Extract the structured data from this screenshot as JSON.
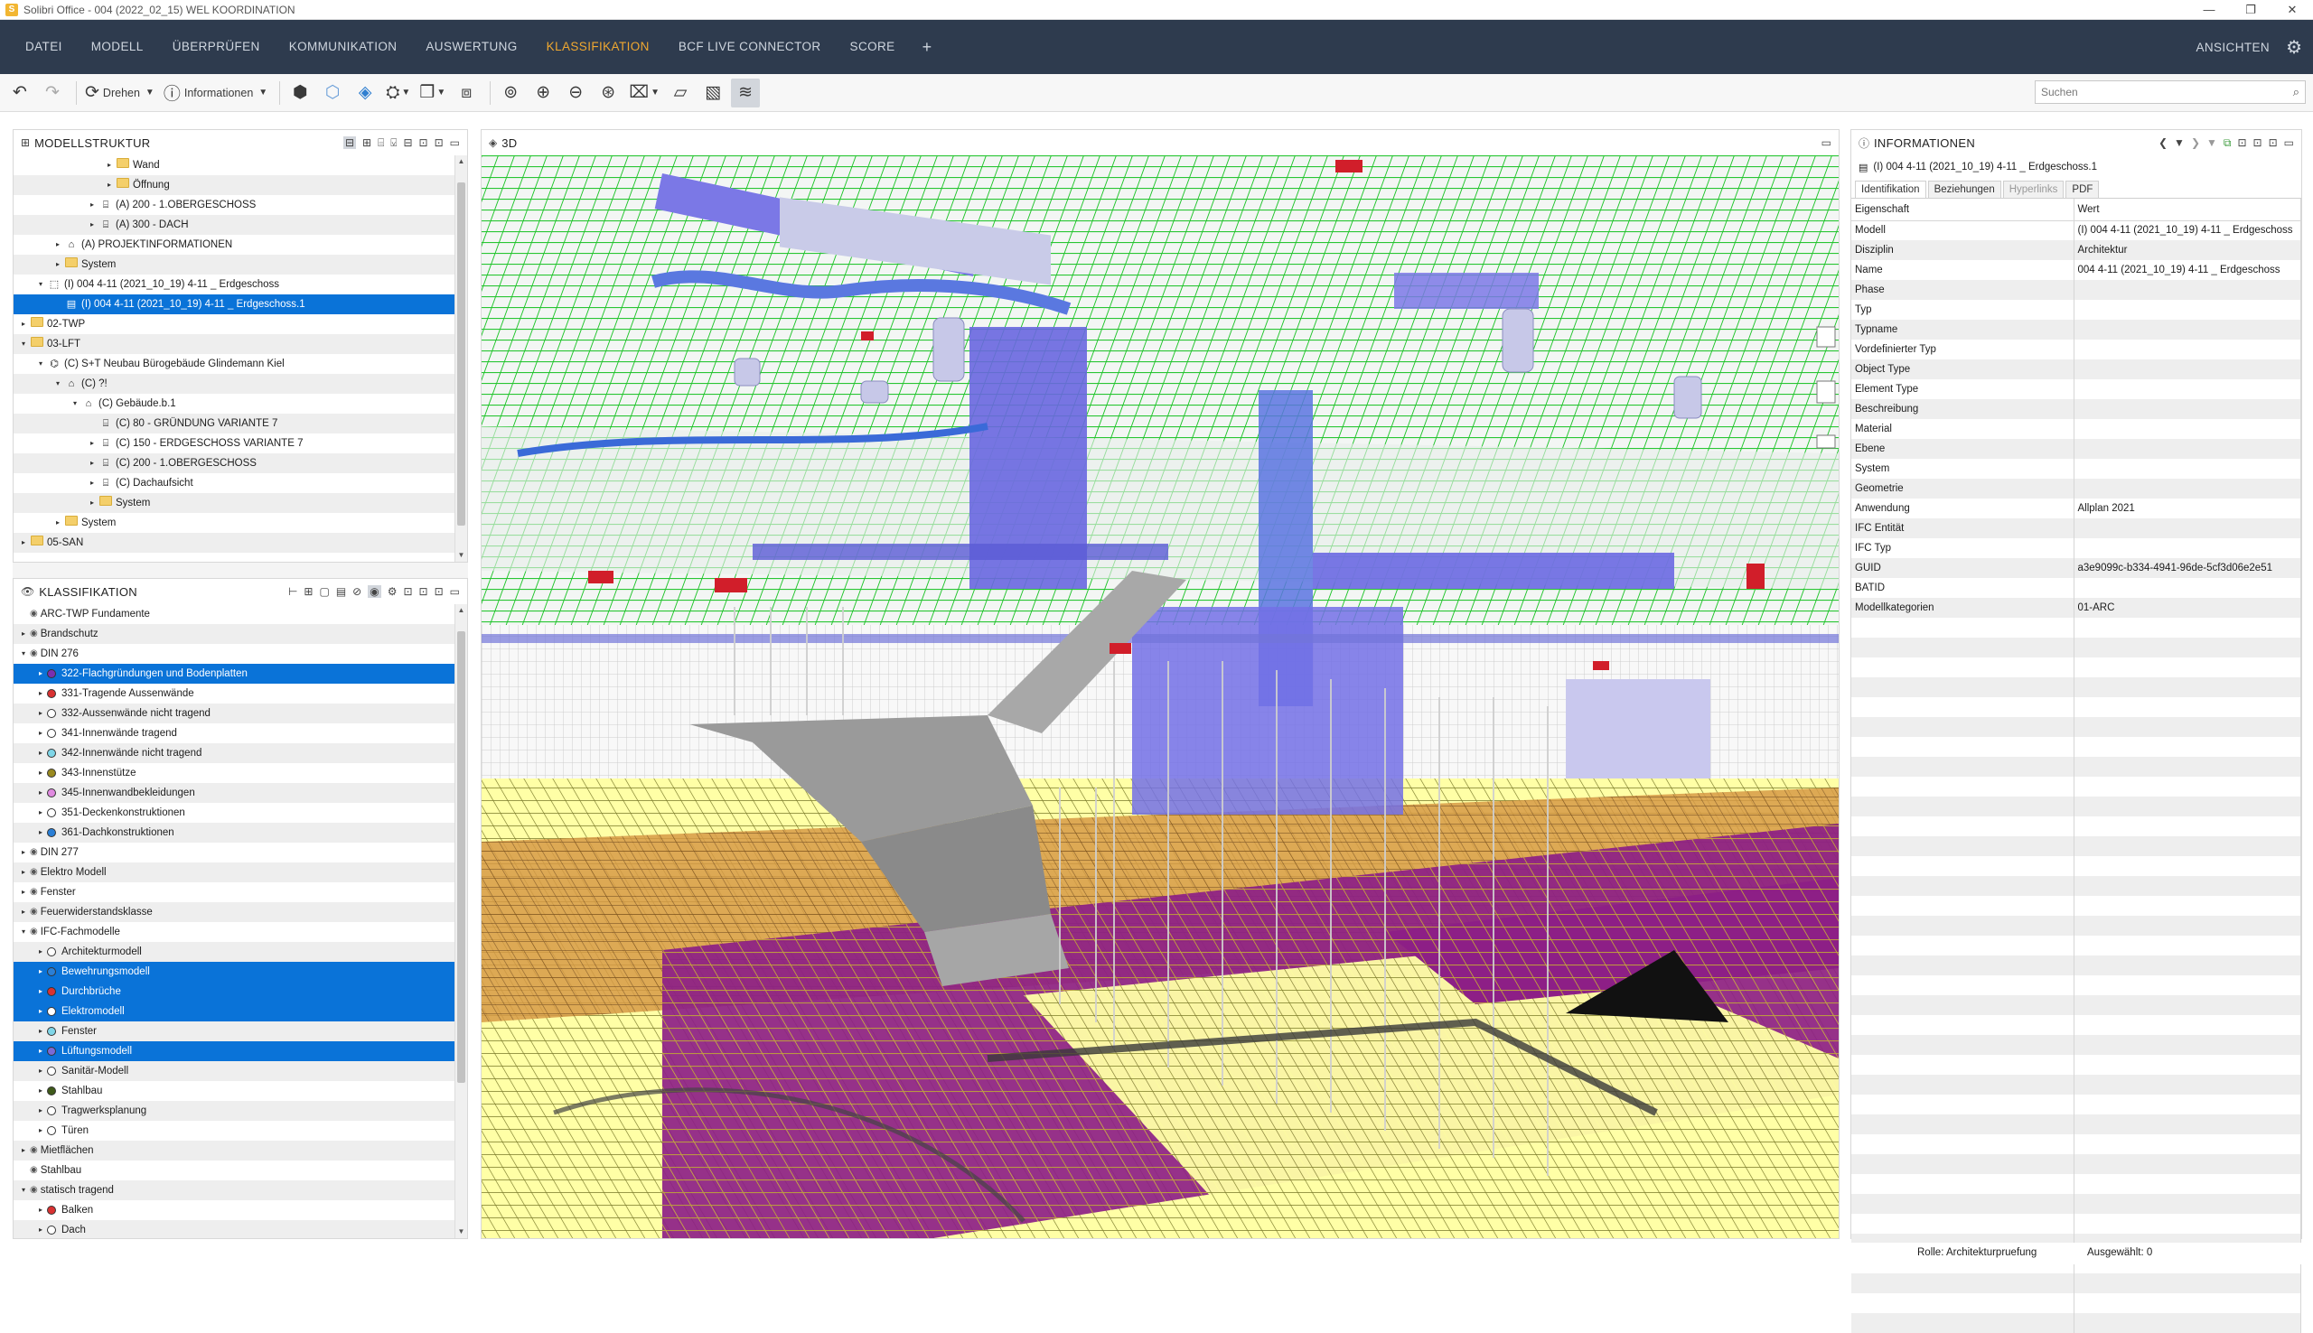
{
  "window": {
    "title": "Solibri Office - 004 (2022_02_15) WEL KOORDINATION",
    "buttons": [
      "—",
      "❐",
      "✕"
    ]
  },
  "menu": {
    "items": [
      "DATEI",
      "MODELL",
      "ÜBERPRÜFEN",
      "KOMMUNIKATION",
      "AUSWERTUNG",
      "KLASSIFIKATION",
      "BCF LIVE CONNECTOR",
      "SCORE"
    ],
    "active": "KLASSIFIKATION",
    "plus": "+",
    "ansichten": "ANSICHTEN"
  },
  "toolbar": {
    "drehen": "Drehen",
    "informationen": "Informationen",
    "search_placeholder": "Suchen"
  },
  "model_panel": {
    "title": "MODELLSTRUKTUR",
    "rows": [
      {
        "indent": 5,
        "exp": "▸",
        "icon": "folder",
        "label": "Wand"
      },
      {
        "indent": 5,
        "exp": "▸",
        "icon": "folder",
        "label": "Öffnung"
      },
      {
        "indent": 4,
        "exp": "▸",
        "icon": "storey",
        "label": "(A) 200 - 1.OBERGESCHOSS"
      },
      {
        "indent": 4,
        "exp": "▸",
        "icon": "storey",
        "label": "(A) 300 - DACH"
      },
      {
        "indent": 2,
        "exp": "▸",
        "icon": "site",
        "label": "(A) PROJEKTINFORMATIONEN"
      },
      {
        "indent": 2,
        "exp": "▸",
        "icon": "folder",
        "label": "System"
      },
      {
        "indent": 1,
        "exp": "▾",
        "icon": "model",
        "label": "(I) 004 4-11  (2021_10_19) 4-11 _ Erdgeschoss"
      },
      {
        "indent": 2,
        "exp": "",
        "icon": "doc",
        "label": "(I) 004 4-11  (2021_10_19) 4-11 _ Erdgeschoss.1",
        "selected": true
      },
      {
        "indent": 0,
        "exp": "▸",
        "icon": "folder",
        "label": "02-TWP"
      },
      {
        "indent": 0,
        "exp": "▾",
        "icon": "folder",
        "label": "03-LFT"
      },
      {
        "indent": 1,
        "exp": "▾",
        "icon": "project",
        "label": "(C) S+T Neubau Bürogebäude Glindemann Kiel"
      },
      {
        "indent": 2,
        "exp": "▾",
        "icon": "site",
        "label": "(C) ?!"
      },
      {
        "indent": 3,
        "exp": "▾",
        "icon": "building",
        "label": "(C) Gebäude.b.1"
      },
      {
        "indent": 4,
        "exp": "",
        "icon": "storey",
        "label": "(C) 80 - GRÜNDUNG VARIANTE 7"
      },
      {
        "indent": 4,
        "exp": "▸",
        "icon": "storey",
        "label": "(C) 150 - ERDGESCHOSS VARIANTE 7"
      },
      {
        "indent": 4,
        "exp": "▸",
        "icon": "storey",
        "label": "(C) 200 - 1.OBERGESCHOSS"
      },
      {
        "indent": 4,
        "exp": "▸",
        "icon": "storey",
        "label": "(C) Dachaufsicht"
      },
      {
        "indent": 4,
        "exp": "▸",
        "icon": "folder",
        "label": "System"
      },
      {
        "indent": 2,
        "exp": "▸",
        "icon": "folder",
        "label": "System"
      },
      {
        "indent": 0,
        "exp": "▸",
        "icon": "folder",
        "label": "05-SAN"
      }
    ]
  },
  "class_panel": {
    "title": "KLASSIFIKATION",
    "rows": [
      {
        "indent": 0,
        "exp": "",
        "dot": "",
        "label": "ARC-TWP Fundamente"
      },
      {
        "indent": 0,
        "exp": "▸",
        "dot": "",
        "label": "Brandschutz"
      },
      {
        "indent": 0,
        "exp": "▾",
        "dot": "",
        "label": "DIN 276"
      },
      {
        "indent": 1,
        "exp": "▸",
        "dot": "#7a2fb0",
        "label": "322-Flachgründungen und Bodenplatten",
        "selected": true
      },
      {
        "indent": 1,
        "exp": "▸",
        "dot": "#d93232",
        "label": "331-Tragende Aussenwände"
      },
      {
        "indent": 1,
        "exp": "▸",
        "dot": "#ffffff",
        "label": "332-Aussenwände nicht tragend"
      },
      {
        "indent": 1,
        "exp": "▸",
        "dot": "#ffffff",
        "label": "341-Innenwände tragend"
      },
      {
        "indent": 1,
        "exp": "▸",
        "dot": "#7fd6e8",
        "label": "342-Innenwände nicht tragend"
      },
      {
        "indent": 1,
        "exp": "▸",
        "dot": "#9a8a20",
        "label": "343-Innenstütze"
      },
      {
        "indent": 1,
        "exp": "▸",
        "dot": "#e08ae0",
        "label": "345-Innenwandbekleidungen"
      },
      {
        "indent": 1,
        "exp": "▸",
        "dot": "#ffffff",
        "label": "351-Deckenkonstruktionen"
      },
      {
        "indent": 1,
        "exp": "▸",
        "dot": "#2a7fd6",
        "label": "361-Dachkonstruktionen"
      },
      {
        "indent": 0,
        "exp": "▸",
        "dot": "",
        "label": "DIN 277"
      },
      {
        "indent": 0,
        "exp": "▸",
        "dot": "",
        "label": "Elektro Modell"
      },
      {
        "indent": 0,
        "exp": "▸",
        "dot": "",
        "label": "Fenster"
      },
      {
        "indent": 0,
        "exp": "▸",
        "dot": "",
        "label": "Feuerwiderstandsklasse"
      },
      {
        "indent": 0,
        "exp": "▾",
        "dot": "",
        "label": "IFC-Fachmodelle"
      },
      {
        "indent": 1,
        "exp": "▸",
        "dot": "#ffffff",
        "label": "Architekturmodell"
      },
      {
        "indent": 1,
        "exp": "▸",
        "dot": "#2a7fd6",
        "label": "Bewehrungsmodell",
        "selected": true
      },
      {
        "indent": 1,
        "exp": "▸",
        "dot": "#d93232",
        "label": "Durchbrüche",
        "selected": true
      },
      {
        "indent": 1,
        "exp": "▸",
        "dot": "#ffffff",
        "label": "Elektromodell",
        "selected": true
      },
      {
        "indent": 1,
        "exp": "▸",
        "dot": "#7fd6e8",
        "label": "Fenster"
      },
      {
        "indent": 1,
        "exp": "▸",
        "dot": "#7a6ad6",
        "label": "Lüftungsmodell",
        "selected": true
      },
      {
        "indent": 1,
        "exp": "▸",
        "dot": "#ffffff",
        "label": "Sanitär-Modell"
      },
      {
        "indent": 1,
        "exp": "▸",
        "dot": "#3f5a1a",
        "label": "Stahlbau"
      },
      {
        "indent": 1,
        "exp": "▸",
        "dot": "#ffffff",
        "label": "Tragwerksplanung"
      },
      {
        "indent": 1,
        "exp": "▸",
        "dot": "#ffffff",
        "label": "Türen"
      },
      {
        "indent": 0,
        "exp": "▸",
        "dot": "",
        "label": "Mietflächen"
      },
      {
        "indent": 0,
        "exp": "",
        "dot": "",
        "label": "Stahlbau"
      },
      {
        "indent": 0,
        "exp": "▾",
        "dot": "",
        "label": "statisch tragend"
      },
      {
        "indent": 1,
        "exp": "▸",
        "dot": "#d93232",
        "label": "Balken"
      },
      {
        "indent": 1,
        "exp": "▸",
        "dot": "#ffffff",
        "label": "Dach"
      }
    ]
  },
  "view3d": {
    "title": "3D"
  },
  "info_panel": {
    "title": "INFORMATIONEN",
    "object": "(I) 004 4-11  (2021_10_19) 4-11 _ Erdgeschoss.1",
    "tabs": [
      "Identifikation",
      "Beziehungen",
      "Hyperlinks",
      "PDF"
    ],
    "active_tab": "Identifikation",
    "col_property": "Eigenschaft",
    "col_value": "Wert",
    "rows": [
      {
        "k": "Modell",
        "v": "(I) 004 4-11  (2021_10_19) 4-11 _ Erdgeschoss"
      },
      {
        "k": "Disziplin",
        "v": "Architektur"
      },
      {
        "k": "Name",
        "v": "004 4-11  (2021_10_19) 4-11 _ Erdgeschoss"
      },
      {
        "k": "Phase",
        "v": ""
      },
      {
        "k": "Typ",
        "v": ""
      },
      {
        "k": "Typname",
        "v": ""
      },
      {
        "k": "Vordefinierter Typ",
        "v": ""
      },
      {
        "k": "Object Type",
        "v": ""
      },
      {
        "k": "Element Type",
        "v": ""
      },
      {
        "k": "Beschreibung",
        "v": ""
      },
      {
        "k": "Material",
        "v": ""
      },
      {
        "k": "Ebene",
        "v": ""
      },
      {
        "k": "System",
        "v": ""
      },
      {
        "k": "Geometrie",
        "v": ""
      },
      {
        "k": "Anwendung",
        "v": "Allplan 2021"
      },
      {
        "k": "IFC Entität",
        "v": ""
      },
      {
        "k": "IFC Typ",
        "v": ""
      },
      {
        "k": "GUID",
        "v": "a3e9099c-b334-4941-96de-5cf3d06e2e51"
      },
      {
        "k": "BATID",
        "v": ""
      },
      {
        "k": "Modellkategorien",
        "v": "01-ARC"
      }
    ],
    "empty_rows": 36
  },
  "status": {
    "rolle": "Rolle: Architekturpruefung",
    "ausgewaehlt": "Ausgewählt: 0"
  },
  "colors": {
    "menubar": "#2e3b4e",
    "accent": "#f0a830",
    "selection": "#0a73d8"
  }
}
